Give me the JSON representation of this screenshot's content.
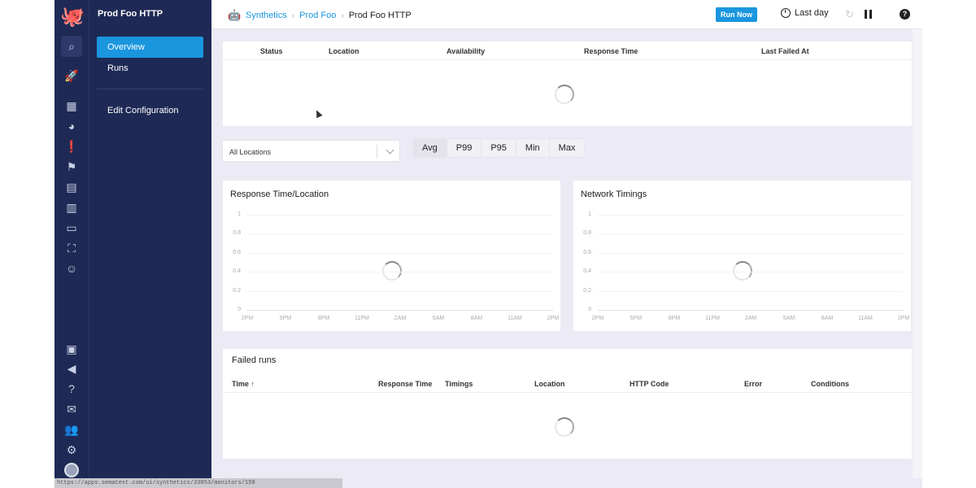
{
  "rail": {
    "icons": [
      "octopus-logo",
      "search-icon",
      "rocket-icon",
      "grid-icon",
      "dashboard-icon",
      "alert-icon",
      "flag-icon",
      "inbox-icon",
      "chart-icon",
      "document-icon",
      "scan-icon",
      "robot-icon",
      "gift-icon",
      "megaphone-icon",
      "help-circle-icon",
      "mail-icon",
      "team-icon",
      "gear-icon",
      "avatar"
    ]
  },
  "subnav": {
    "title": "Prod Foo HTTP",
    "items": [
      {
        "label": "Overview"
      },
      {
        "label": "Runs"
      },
      {
        "label": "Edit Configuration"
      }
    ]
  },
  "topbar": {
    "crumbs": [
      "Synthetics",
      "Prod Foo",
      "Prod Foo HTTP"
    ],
    "run_now": "Run Now",
    "time_range": "Last day"
  },
  "status_table": {
    "headers": [
      "Status",
      "Location",
      "Availability",
      "Response Time",
      "Last Failed At"
    ]
  },
  "filters": {
    "location_select": "All Locations",
    "aggregations": [
      "Avg",
      "P99",
      "P95",
      "Min",
      "Max"
    ],
    "active_aggregation": "Avg"
  },
  "charts": [
    {
      "title": "Response Time/Location"
    },
    {
      "title": "Network Timings"
    }
  ],
  "chart_data": [
    {
      "type": "line",
      "title": "Response Time/Location",
      "ylim": [
        0,
        1
      ],
      "yticks": [
        "1",
        "0.8",
        "0.6",
        "0.4",
        "0.2",
        "0"
      ],
      "xticks": [
        "2PM",
        "5PM",
        "8PM",
        "11PM",
        "2AM",
        "5AM",
        "8AM",
        "11AM",
        "2PM"
      ],
      "series": []
    },
    {
      "type": "line",
      "title": "Network Timings",
      "ylim": [
        0,
        1
      ],
      "yticks": [
        "1",
        "0.8",
        "0.6",
        "0.4",
        "0.2",
        "0"
      ],
      "xticks": [
        "2PM",
        "5PM",
        "8PM",
        "11PM",
        "2AM",
        "5AM",
        "8AM",
        "11AM",
        "2PM"
      ],
      "series": []
    }
  ],
  "failed_runs": {
    "title": "Failed runs",
    "headers": [
      "Time ↑",
      "Response Time",
      "Timings",
      "Location",
      "HTTP Code",
      "Error",
      "Conditions"
    ]
  },
  "statusbar": "https://apps.sematext.com/ui/synthetics/33053/monitors/158"
}
